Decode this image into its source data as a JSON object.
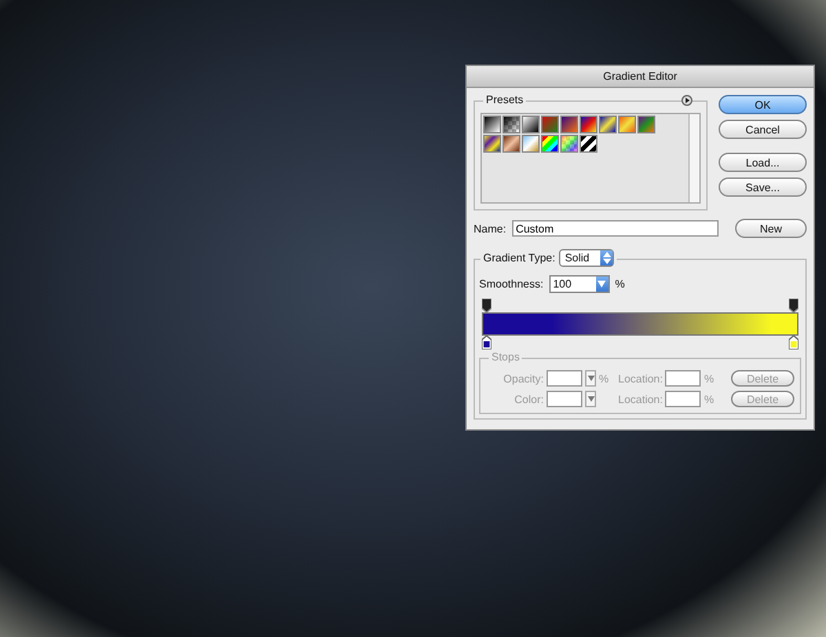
{
  "dialog": {
    "title": "Gradient Editor",
    "presets": {
      "label": "Presets"
    },
    "buttons": [
      {
        "label": "OK",
        "default": true
      },
      {
        "label": "Cancel",
        "default": false
      },
      {
        "label": "Load...",
        "default": false
      },
      {
        "label": "Save...",
        "default": false
      }
    ],
    "name": {
      "label": "Name:",
      "value": "Custom",
      "button": "New"
    },
    "gradient_type": {
      "label": "Gradient Type:",
      "value": "Solid"
    },
    "smoothness": {
      "label": "Smoothness:",
      "value": "100",
      "unit": "%"
    },
    "gradient_stops": [
      {
        "color": "#1a0a9a"
      },
      {
        "color": "#f8f820"
      }
    ],
    "stops": {
      "label": "Stops",
      "disabled": true,
      "rows": [
        {
          "label": "Opacity:",
          "unit": "%",
          "location_label": "Location:",
          "location_unit": "%",
          "button": "Delete"
        },
        {
          "label": "Color:",
          "unit": "",
          "location_label": "Location:",
          "location_unit": "%",
          "button": "Delete"
        }
      ]
    }
  }
}
